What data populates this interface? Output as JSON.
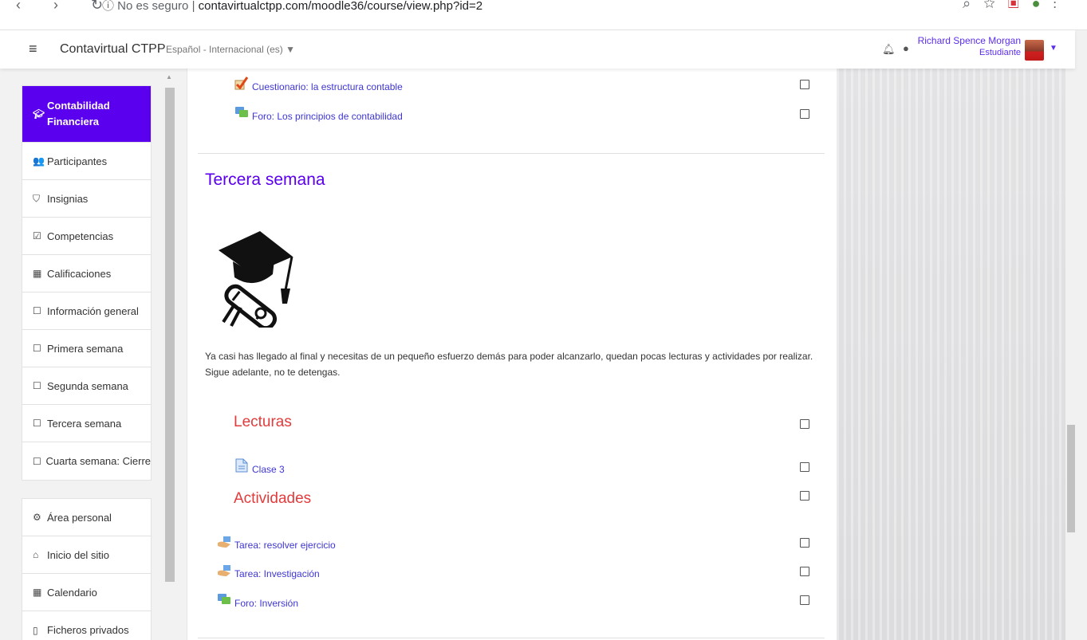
{
  "browser": {
    "nav_glyphs": "‹ › ↻",
    "security": "ⓘ No es seguro",
    "url": "contavirtualctpp.com/moodle36/course/view.php?id=2"
  },
  "header": {
    "menu_icon": "hamburger-icon",
    "site_name": "Contavirtual CTPP",
    "language": "Español - Internacional (es) ▼",
    "user_name": "Richard Spence Morgan",
    "user_role": "Estudiante"
  },
  "sidebar": {
    "course": "Contabilidad Financiera",
    "items": [
      {
        "icon": "👥",
        "label": "Participantes"
      },
      {
        "icon": "⛉",
        "label": "Insignias"
      },
      {
        "icon": "☑",
        "label": "Competencias"
      },
      {
        "icon": "▦",
        "label": "Calificaciones"
      },
      {
        "icon": "☐",
        "label": "Información general"
      },
      {
        "icon": "☐",
        "label": "Primera semana"
      },
      {
        "icon": "☐",
        "label": "Segunda semana"
      },
      {
        "icon": "☐",
        "label": "Tercera semana"
      },
      {
        "icon": "☐",
        "label": "Cuarta semana: Cierre"
      }
    ],
    "personal": [
      {
        "icon": "⚙",
        "label": "Área personal"
      },
      {
        "icon": "⌂",
        "label": "Inicio del sitio"
      },
      {
        "icon": "▦",
        "label": "Calendario"
      },
      {
        "icon": "▯",
        "label": "Ficheros privados"
      }
    ]
  },
  "main": {
    "prev_activities": [
      {
        "icon": "quiz-icon",
        "label": "Cuestionario: la estructura contable"
      },
      {
        "icon": "forum-icon",
        "label": "Foro: Los principios de contabilidad"
      }
    ],
    "section_title": "Tercera semana",
    "summary": "Ya casi has llegado al final y necesitas de un pequeño esfuerzo demás para poder alcanzarlo, quedan pocas lecturas y actividades por realizar. Sigue adelante, no te detengas.",
    "readings_heading": "Lecturas",
    "reading": {
      "icon": "page-icon",
      "label": "Clase 3"
    },
    "activities_heading": "Actividades",
    "activities": [
      {
        "icon": "assignment-icon",
        "label": "Tarea: resolver ejercicio"
      },
      {
        "icon": "assignment-icon",
        "label": "Tarea: Investigación"
      },
      {
        "icon": "forum-icon",
        "label": "Foro: Inversión"
      }
    ]
  },
  "colors": {
    "accent": "#5b00ee",
    "link": "#3e35d6",
    "subheading": "#e23b3b"
  }
}
